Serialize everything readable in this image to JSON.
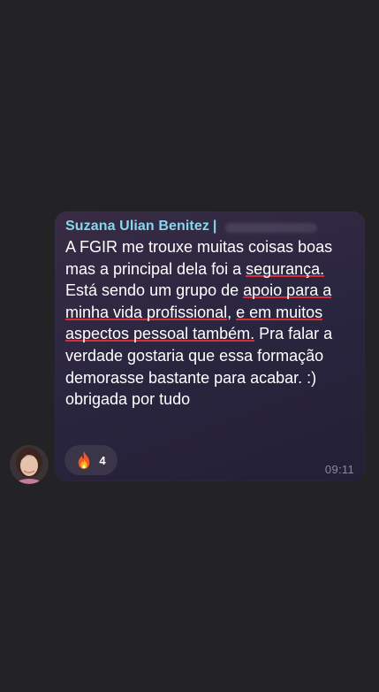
{
  "message": {
    "sender": "Suzana Ulian Benitez",
    "separator": "|",
    "text_parts": [
      "A FGIR me trouxe muitas coisas boas mas a principal dela foi a ",
      "segurança.",
      " Está sendo um grupo de ",
      "apoio para a minha vida profissional",
      ", ",
      "e em muitos aspectos pessoal também.",
      " Pra falar a verdade gostaria que essa formação demorasse bastante para acabar. :) obrigada por tudo"
    ],
    "reaction": {
      "emoji": "fire-icon",
      "count": "4"
    },
    "time": "09:11"
  },
  "colors": {
    "background": "#232224",
    "sender_name": "#87d7ec",
    "underline": "#d62d3a",
    "bubble": "#2b2640",
    "timestamp": "#8e8a9e"
  }
}
